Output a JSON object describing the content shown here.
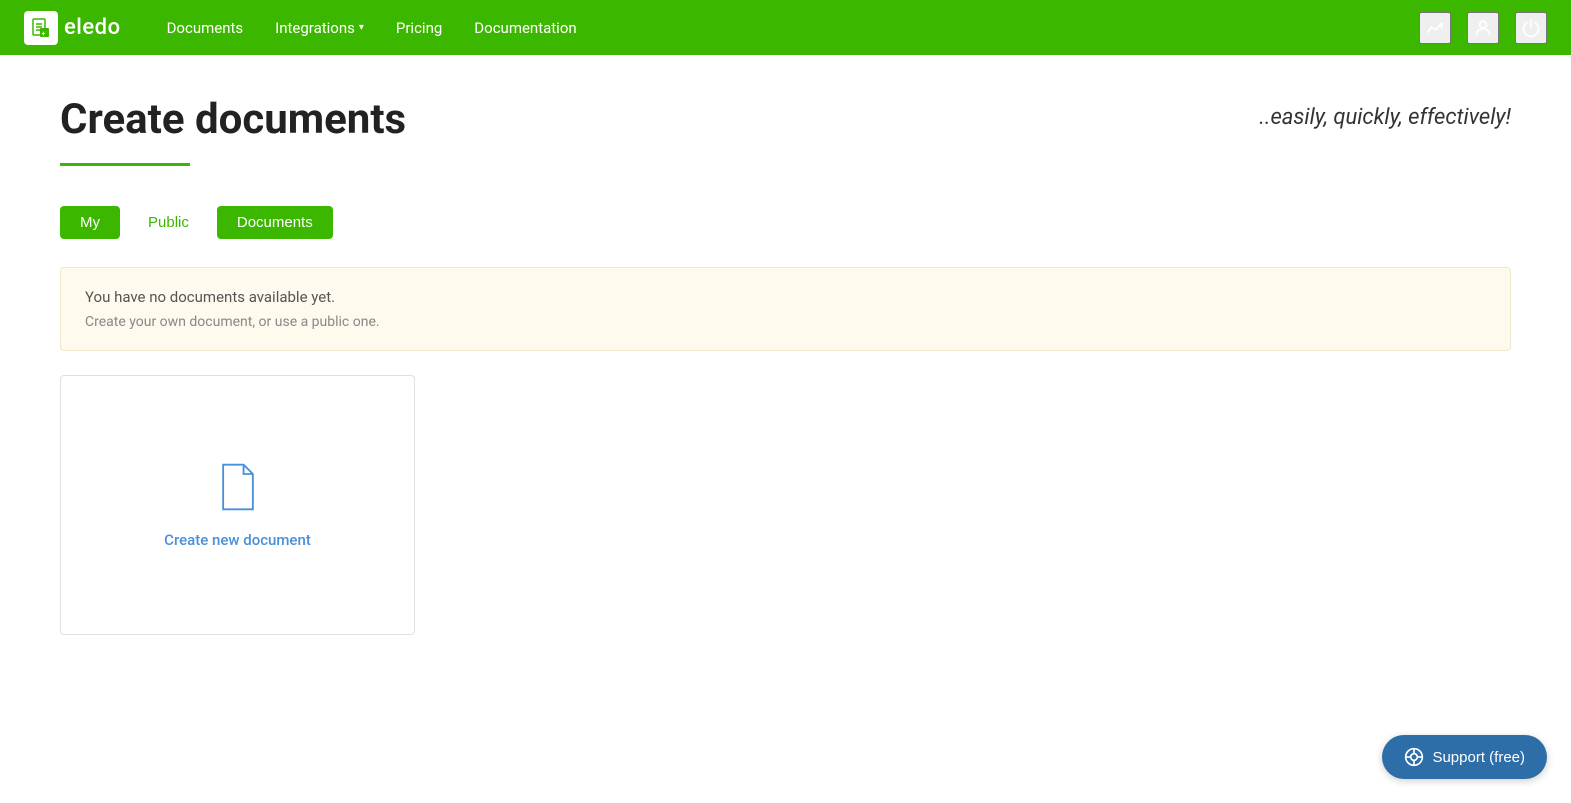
{
  "brand": {
    "logo_text": "eledo"
  },
  "navbar": {
    "links": [
      {
        "label": "Documents",
        "has_dropdown": false
      },
      {
        "label": "Integrations",
        "has_dropdown": true
      },
      {
        "label": "Pricing",
        "has_dropdown": false
      },
      {
        "label": "Documentation",
        "has_dropdown": false
      }
    ],
    "icons": [
      "chart-icon",
      "user-icon",
      "power-icon"
    ]
  },
  "hero": {
    "title": "Create documents",
    "tagline": "..easily, quickly, effectively!"
  },
  "tabs": [
    {
      "label": "My",
      "active": true,
      "style": "green-filled"
    },
    {
      "label": "Public",
      "active": false,
      "style": "text"
    },
    {
      "label": "Documents",
      "active": true,
      "style": "green-filled"
    }
  ],
  "alert": {
    "title": "You have no documents available yet.",
    "body": "Create your own document, or use a public one."
  },
  "new_document_card": {
    "label": "Create new document"
  },
  "support_button": {
    "label": "Support (free)"
  },
  "colors": {
    "brand_green": "#3cb700",
    "nav_bg": "#3cb700",
    "accent_blue": "#4a90d9",
    "support_btn_bg": "#2d6ea8"
  }
}
